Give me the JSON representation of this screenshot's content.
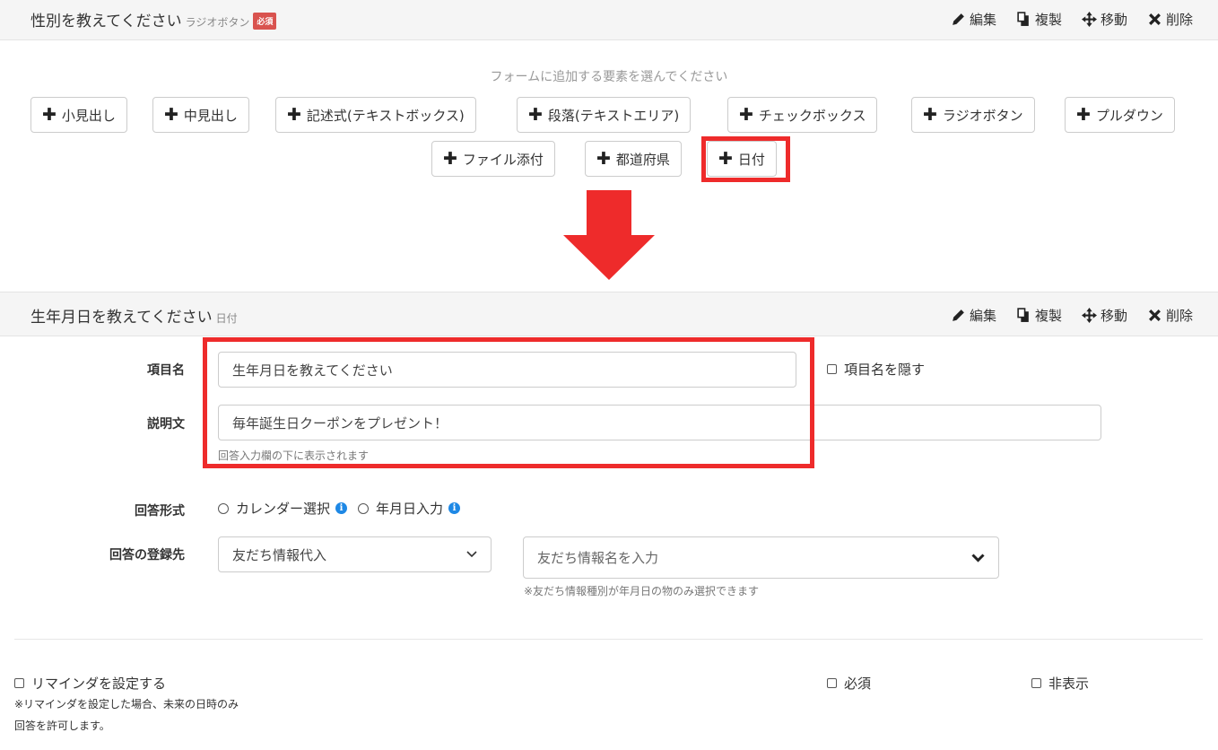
{
  "top_item": {
    "title": "性別を教えてください",
    "type": "ラジオボタン",
    "badge": "必須"
  },
  "actions": {
    "edit": "編集",
    "copy": "複製",
    "move": "移動",
    "delete": "削除"
  },
  "add_panel": {
    "hint": "フォームに追加する要素を選んでください",
    "buttons": [
      "小見出し",
      "中見出し",
      "記述式(テキストボックス)",
      "段落(テキストエリア)",
      "チェックボックス",
      "ラジオボタン",
      "プルダウン",
      "ファイル添付",
      "都道府県",
      "日付"
    ]
  },
  "date_item": {
    "title": "生年月日を教えてください",
    "type": "日付",
    "item_name_label": "項目名",
    "item_name_value": "生年月日を教えてください",
    "hide_name_label": "項目名を隠す",
    "description_label": "説明文",
    "description_value": "毎年誕生日クーポンをプレゼント！",
    "description_help": "回答入力欄の下に表示されます",
    "answer_format_label": "回答形式",
    "answer_format_options": [
      "カレンダー選択",
      "年月日入力"
    ],
    "register_label": "回答の登録先",
    "register_select": "友だち情報代入",
    "friend_info_placeholder": "友だち情報名を入力",
    "friend_info_help": "※友だち情報種別が年月日の物のみ選択できます",
    "reminder_label": "リマインダを設定する",
    "reminder_note_1": "※リマインダを設定した場合、未来の日時のみ",
    "reminder_note_2": "回答を許可します。",
    "required_label": "必須",
    "hidden_label": "非表示"
  },
  "colors": {
    "highlight": "#ee2b2b",
    "badge": "#d9534f",
    "info": "#1e88e5"
  }
}
